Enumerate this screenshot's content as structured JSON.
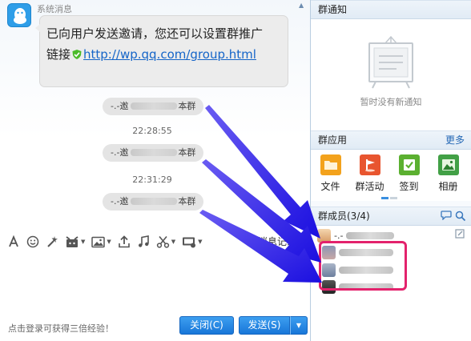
{
  "chat": {
    "sender": "系统消息",
    "message_line1": "已向用户发送邀请，您还可以设置群推广",
    "message_line2_prefix": "链接",
    "message_link": "http://wp.qq.com/group.html",
    "invites": [
      {
        "prefix": "-.-邀",
        "suffix": "本群"
      },
      {
        "prefix": "-.-邀",
        "suffix": "本群"
      },
      {
        "prefix": "-.-邀",
        "suffix": "本群"
      }
    ],
    "times": [
      "22:28:55",
      "22:31:29"
    ]
  },
  "toolbar": {
    "icons": [
      "font-icon",
      "emoji-icon",
      "magic-icon",
      "gift-icon",
      "image-icon",
      "upload-icon",
      "music-icon",
      "screenshot-icon",
      "remote-icon"
    ],
    "history_label": "消息记录"
  },
  "footer": {
    "tip": "点击登录可获得三倍经验！",
    "close_label": "关闭(C)",
    "send_label": "发送(S)"
  },
  "sidebar": {
    "notice_title": "群通知",
    "notice_empty": "暂时没有新通知",
    "apps_title": "群应用",
    "apps_more": "更多",
    "apps": [
      {
        "label": "文件",
        "icon": "folder-icon",
        "color": "#f3a21c"
      },
      {
        "label": "群活动",
        "icon": "flag-icon",
        "color": "#e8552f"
      },
      {
        "label": "签到",
        "icon": "checkin-icon",
        "color": "#5bb030"
      },
      {
        "label": "相册",
        "icon": "album-icon",
        "color": "#42a046"
      }
    ],
    "members_title": "群成员(3/4)",
    "member_owner_prefix": "-.-"
  },
  "colors": {
    "accent": "#1876d8",
    "highlight": "#e3226c",
    "arrow": "#2a1fe6"
  }
}
